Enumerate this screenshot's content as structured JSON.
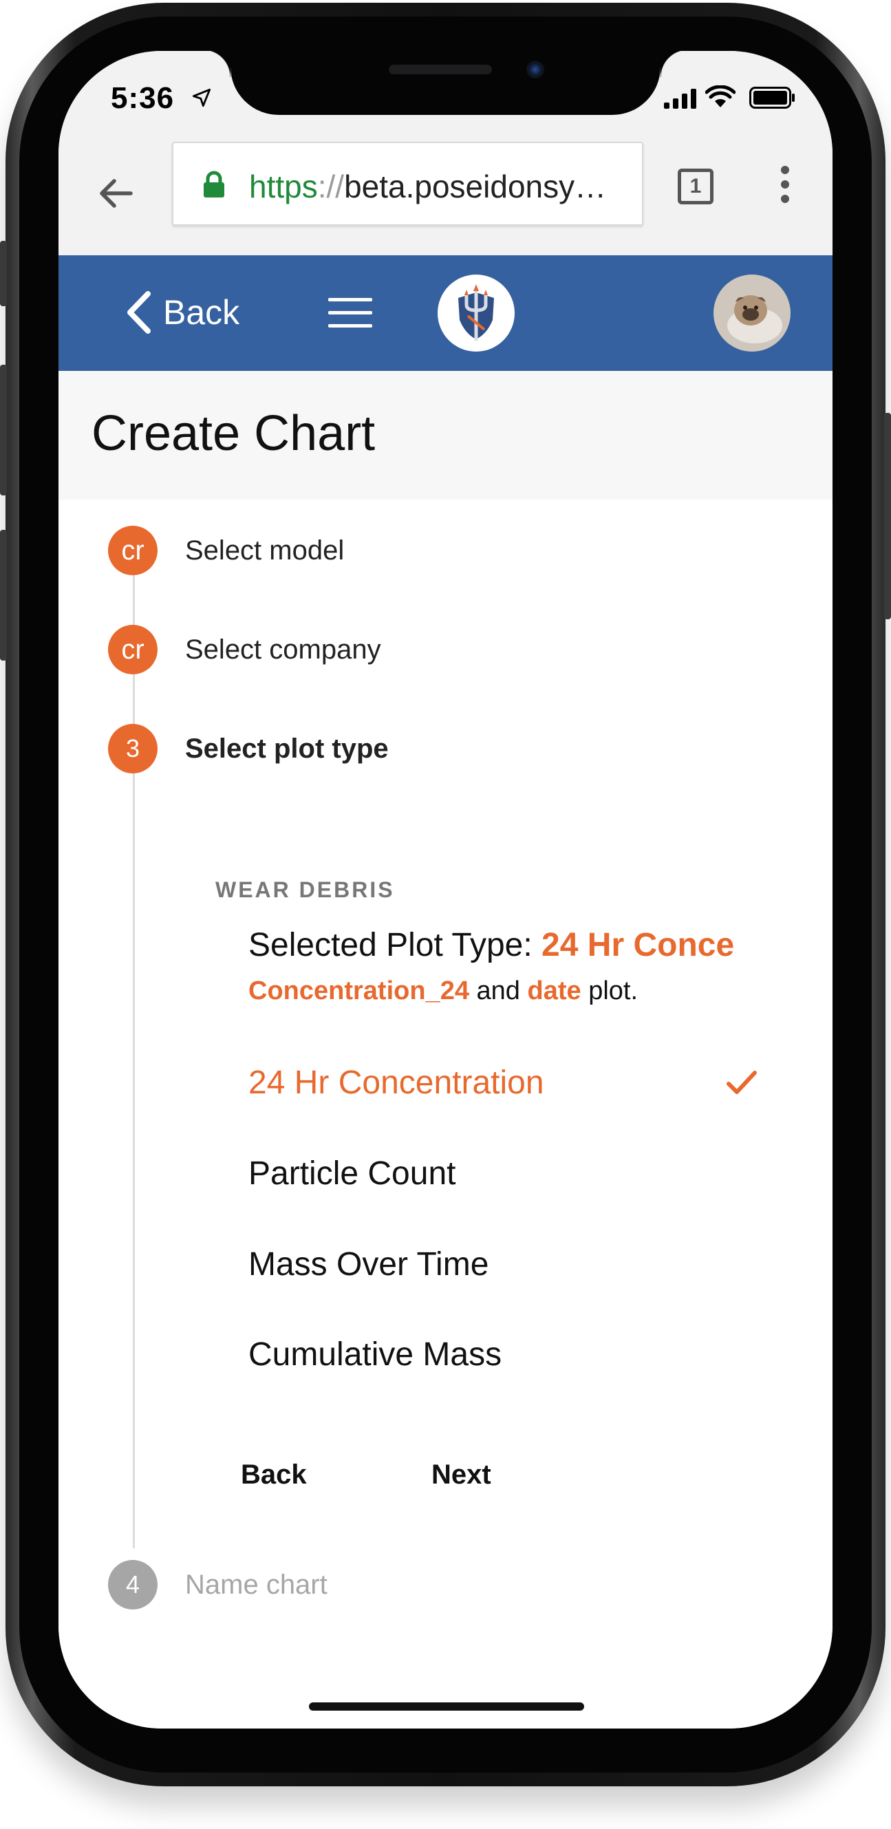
{
  "status_bar": {
    "time": "5:36"
  },
  "browser": {
    "url_scheme": "https",
    "url_separator": "://",
    "url_rest": "beta.poseidonsy…",
    "tab_count": "1"
  },
  "header": {
    "back_label": "Back"
  },
  "page": {
    "title": "Create Chart"
  },
  "steps": [
    {
      "badge": "cr",
      "label": "Select model"
    },
    {
      "badge": "cr",
      "label": "Select company"
    },
    {
      "badge": "3",
      "label": "Select plot type"
    },
    {
      "badge": "4",
      "label": "Name chart"
    }
  ],
  "plot_section": {
    "heading": "WEAR DEBRIS",
    "selected_prefix": "Selected Plot Type: ",
    "selected_value": "24 Hr Conce",
    "desc_field1": "Concentration_24",
    "desc_and": " and ",
    "desc_field2": "date",
    "desc_suffix": " plot.",
    "options": [
      {
        "label": "24 Hr Concentration",
        "selected": true
      },
      {
        "label": "Particle Count",
        "selected": false
      },
      {
        "label": "Mass Over Time",
        "selected": false
      },
      {
        "label": "Cumulative Mass",
        "selected": false
      }
    ],
    "back_button": "Back",
    "next_button": "Next"
  },
  "colors": {
    "header_blue": "#3561a0",
    "accent_orange": "#e8692e",
    "inactive_grey": "#a6a6a6"
  }
}
